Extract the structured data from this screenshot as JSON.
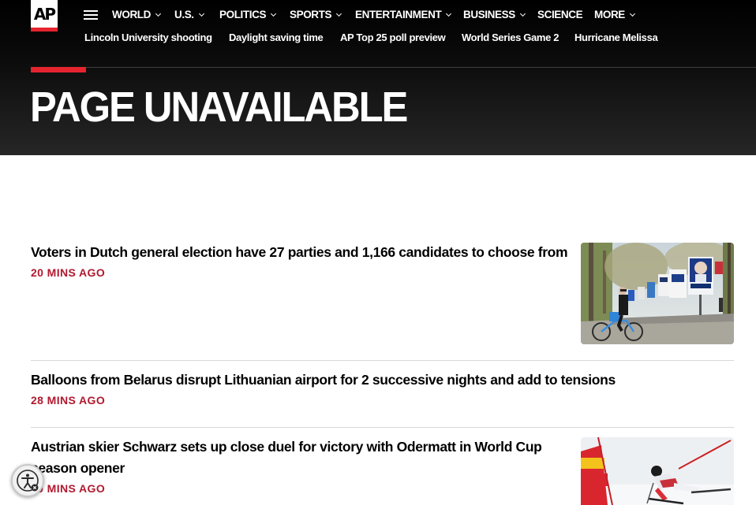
{
  "header": {
    "logo_text": "AP",
    "nav": [
      {
        "label": "WORLD",
        "dropdown": true
      },
      {
        "label": "U.S.",
        "dropdown": true
      },
      {
        "label": "POLITICS",
        "dropdown": true
      },
      {
        "label": "SPORTS",
        "dropdown": true
      },
      {
        "label": "ENTERTAINMENT",
        "dropdown": true
      },
      {
        "label": "BUSINESS",
        "dropdown": true
      },
      {
        "label": "SCIENCE",
        "dropdown": false
      },
      {
        "label": "MORE",
        "dropdown": true
      }
    ],
    "trending": [
      "Lincoln University shooting",
      "Daylight saving time",
      "AP Top 25 poll preview",
      "World Series Game 2",
      "Hurricane Melissa"
    ],
    "page_title": "PAGE UNAVAILABLE"
  },
  "stories": [
    {
      "headline": "Voters in Dutch general election have 27 parties and 1,166 candidates to choose from",
      "time": "20 MINS AGO",
      "image": "cyclist-election-posters-photo"
    },
    {
      "headline": "Balloons from Belarus disrupt Lithuanian airport for 2 successive nights and add to tensions",
      "time": "28 MINS AGO",
      "image": null
    },
    {
      "headline": "Austrian skier Schwarz sets up close duel for victory with Odermatt in World Cup season opener",
      "time": "20 MINS AGO",
      "image": "skier-race-photo"
    }
  ],
  "colors": {
    "accent_red": "#e4242e",
    "timestamp_red": "#b1192f",
    "header_bg": "#000000"
  },
  "icons": {
    "menu": "hamburger-icon",
    "dropdown": "chevron-down-icon",
    "accessibility": "accessibility-icon"
  }
}
